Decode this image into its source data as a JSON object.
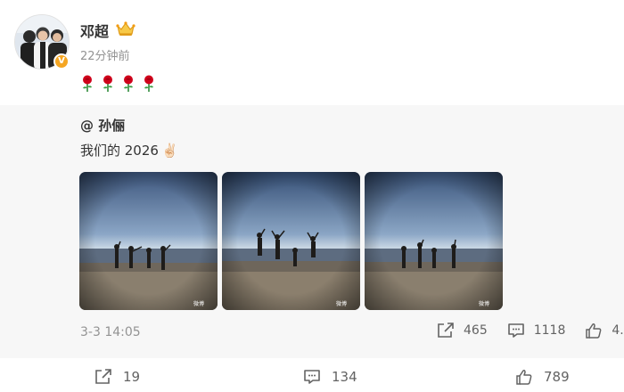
{
  "post": {
    "author": "邓超",
    "time": "22分钟前",
    "rose_count": 4
  },
  "repost": {
    "author": "@ 孙俪",
    "text": "我们的 2026",
    "emoji": "✌🏻",
    "date": "3-3 14:05",
    "reposts": "465",
    "comments": "1118",
    "likes": "4.",
    "photos": [
      "beach-photo-1",
      "beach-photo-2",
      "beach-photo-3"
    ]
  },
  "actions": {
    "reposts": "19",
    "comments": "134",
    "likes": "789"
  },
  "colors": {
    "repost_bg": "#f7f7f7",
    "muted_text": "#939393",
    "badge": "#f5a623",
    "rose": "#d0021b"
  }
}
